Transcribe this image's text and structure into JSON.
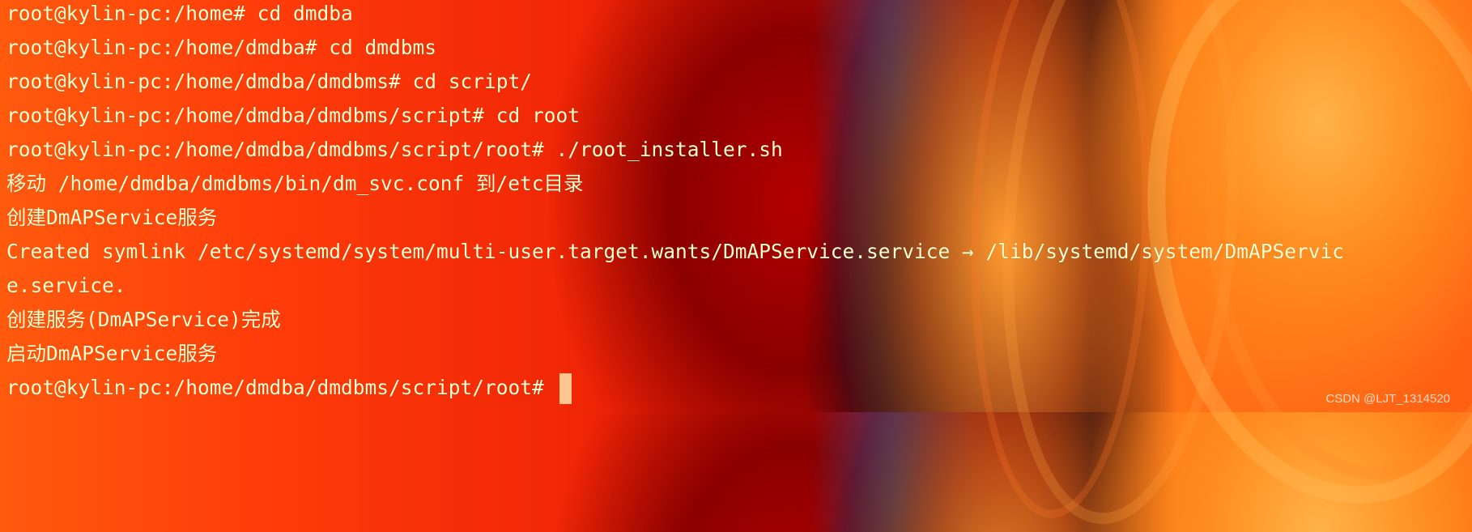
{
  "terminal": {
    "lines": [
      "root@kylin-pc:/home# cd dmdba",
      "root@kylin-pc:/home/dmdba# cd dmdbms",
      "root@kylin-pc:/home/dmdba/dmdbms# cd script/",
      "root@kylin-pc:/home/dmdba/dmdbms/script# cd root",
      "root@kylin-pc:/home/dmdba/dmdbms/script/root# ./root_installer.sh",
      "移动 /home/dmdba/dmdbms/bin/dm_svc.conf 到/etc目录",
      "创建DmAPService服务",
      "Created symlink /etc/systemd/system/multi-user.target.wants/DmAPService.service → /lib/systemd/system/DmAPServic",
      "e.service.",
      "创建服务(DmAPService)完成",
      "启动DmAPService服务",
      "root@kylin-pc:/home/dmdba/dmdbms/script/root# "
    ]
  },
  "watermark": "CSDN @LJT_1314520",
  "colors": {
    "text": "#ffffcf",
    "cursor": "#ffd9a0"
  }
}
